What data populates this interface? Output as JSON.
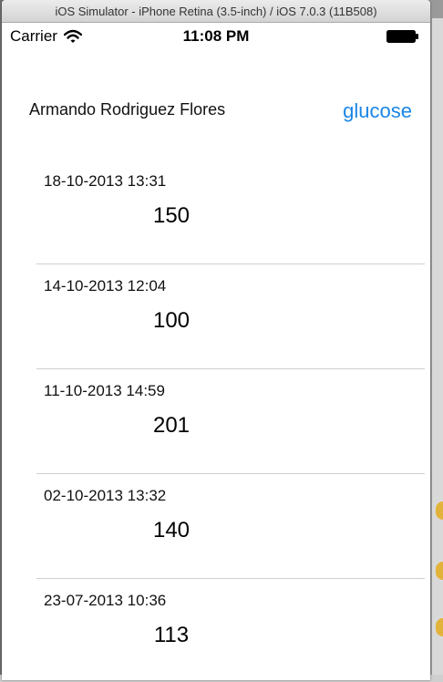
{
  "window": {
    "title": "iOS Simulator - iPhone Retina (3.5-inch) / iOS 7.0.3 (11B508)"
  },
  "status_bar": {
    "carrier": "Carrier",
    "time": "11:08 PM",
    "wifi_icon": "wifi-icon",
    "battery_icon": "battery-icon"
  },
  "header": {
    "patient_name": "Armando Rodriguez Flores",
    "measure_label": "glucose"
  },
  "readings": [
    {
      "date": "18-10-2013 13:31",
      "value": "150"
    },
    {
      "date": "14-10-2013 12:04",
      "value": "100"
    },
    {
      "date": "11-10-2013 14:59",
      "value": "201"
    },
    {
      "date": "02-10-2013 13:32",
      "value": "140"
    },
    {
      "date": "23-07-2013 10:36",
      "value": "113"
    }
  ],
  "colors": {
    "accent": "#1a86e6",
    "separator": "#cfcfcf"
  }
}
